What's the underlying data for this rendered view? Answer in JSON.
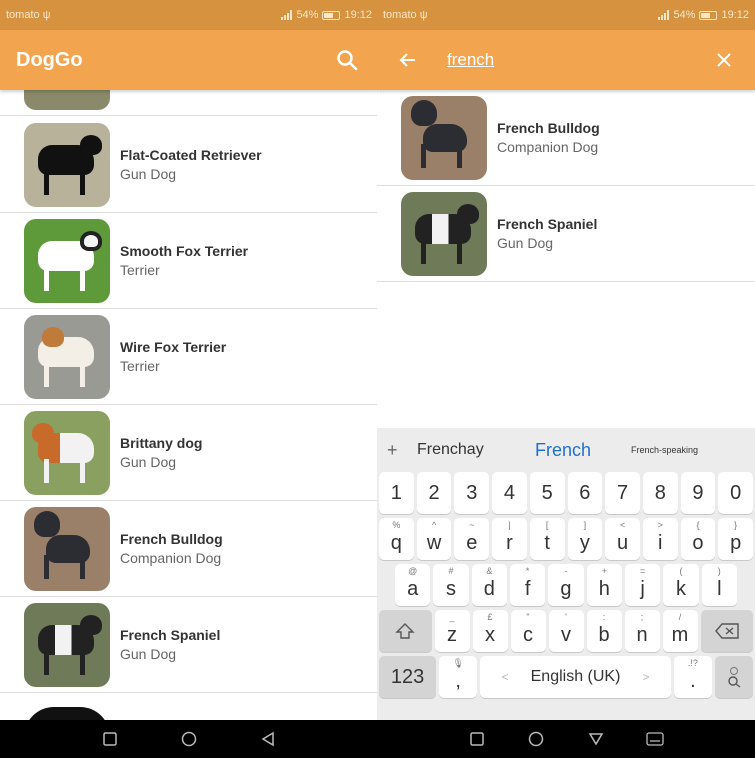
{
  "status": {
    "carrier": "tomato",
    "battery": "54%",
    "time": "19:12"
  },
  "left": {
    "title": "DogGo",
    "dogs": [
      {
        "name": "Flat-Coated Retriever",
        "group": "Gun Dog"
      },
      {
        "name": "Smooth Fox Terrier",
        "group": "Terrier"
      },
      {
        "name": "Wire Fox Terrier",
        "group": "Terrier"
      },
      {
        "name": "Brittany dog",
        "group": "Gun Dog"
      },
      {
        "name": "French Bulldog",
        "group": "Companion Dog"
      },
      {
        "name": "French Spaniel",
        "group": "Gun Dog"
      }
    ]
  },
  "right": {
    "query": "french",
    "results": [
      {
        "name": "French Bulldog",
        "group": "Companion Dog"
      },
      {
        "name": "French Spaniel",
        "group": "Gun Dog"
      }
    ]
  },
  "keyboard": {
    "suggestions": [
      "Frenchay",
      "French",
      "French-speaking"
    ],
    "plus": "+",
    "numbers": [
      "1",
      "2",
      "3",
      "4",
      "5",
      "6",
      "7",
      "8",
      "9",
      "0"
    ],
    "row1": [
      {
        "sup": "%",
        "k": "q"
      },
      {
        "sup": "^",
        "k": "w"
      },
      {
        "sup": "~",
        "k": "e"
      },
      {
        "sup": "|",
        "k": "r"
      },
      {
        "sup": "[",
        "k": "t"
      },
      {
        "sup": "]",
        "k": "y"
      },
      {
        "sup": "<",
        "k": "u"
      },
      {
        "sup": ">",
        "k": "i"
      },
      {
        "sup": "{",
        "k": "o"
      },
      {
        "sup": "}",
        "k": "p"
      }
    ],
    "row2": [
      {
        "sup": "@",
        "k": "a"
      },
      {
        "sup": "#",
        "k": "s"
      },
      {
        "sup": "&",
        "k": "d"
      },
      {
        "sup": "*",
        "k": "f"
      },
      {
        "sup": "-",
        "k": "g"
      },
      {
        "sup": "+",
        "k": "h"
      },
      {
        "sup": "=",
        "k": "j"
      },
      {
        "sup": "(",
        "k": "k"
      },
      {
        "sup": ")",
        "k": "l"
      }
    ],
    "row3": [
      {
        "sup": "_",
        "k": "z"
      },
      {
        "sup": "£",
        "k": "x"
      },
      {
        "sup": "\"",
        "k": "c"
      },
      {
        "sup": "'",
        "k": "v"
      },
      {
        "sup": ":",
        "k": "b"
      },
      {
        "sup": ";",
        "k": "n"
      },
      {
        "sup": "/",
        "k": "m"
      }
    ],
    "mode_key": "123",
    "space_label": "English (UK)",
    "comma": ",",
    "period": ".",
    "period_sup": ".!?"
  },
  "colors": {
    "appbar": "#f2a44f",
    "statusbar": "#d7923f",
    "accent_blue": "#1e6fd0"
  }
}
